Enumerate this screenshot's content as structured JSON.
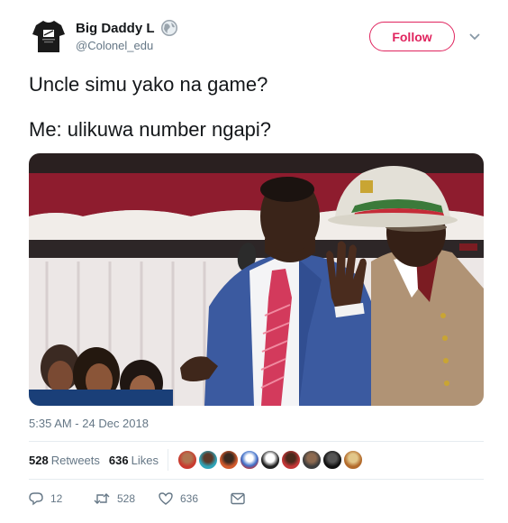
{
  "user": {
    "display_name": "Big Daddy L",
    "handle": "@Colonel_edu"
  },
  "follow_label": "Follow",
  "tweet_lines": [
    "Uncle simu yako na game?",
    "Me: ulikuwa number ngapi?"
  ],
  "timestamp": "5:35 AM - 24 Dec 2018",
  "stats": {
    "retweets_count": "528",
    "retweets_label": "Retweets",
    "likes_count": "636",
    "likes_label": "Likes"
  },
  "actions": {
    "reply_count": "12",
    "retweet_count": "528",
    "like_count": "636"
  },
  "colors": {
    "accent": "#e0245e",
    "muted": "#657786",
    "text": "#14171a"
  },
  "icons": [
    "globe-icon",
    "chevron-down-icon",
    "reply-icon",
    "retweet-icon",
    "heart-icon",
    "message-icon"
  ]
}
